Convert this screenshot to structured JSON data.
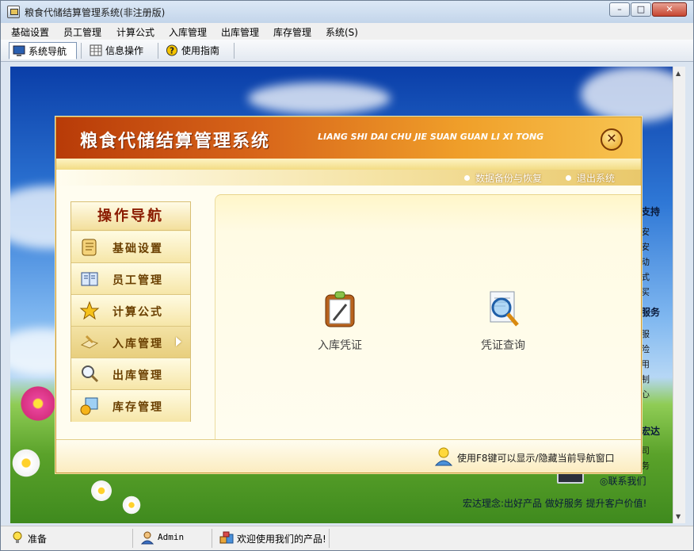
{
  "window": {
    "title": "粮食代储结算管理系统(非注册版)",
    "min_label": "–",
    "max_label": "□",
    "close_label": "✕"
  },
  "menubar": [
    "基础设置",
    "员工管理",
    "计算公式",
    "入库管理",
    "出库管理",
    "库存管理",
    "系统(S)"
  ],
  "toolbar": {
    "items": [
      {
        "label": "系统导航",
        "icon": "monitor-icon",
        "active": true
      },
      {
        "label": "信息操作",
        "icon": "grid-icon",
        "active": false
      },
      {
        "label": "使用指南",
        "icon": "help-icon",
        "active": false
      }
    ]
  },
  "dialog": {
    "title": "粮食代储结算管理系统",
    "subtitle": "LIANG SHI DAI CHU JIE SUAN GUAN LI XI TONG",
    "close_label": "✕",
    "links": [
      "数据备份与恢复",
      "退出系统"
    ],
    "nav_title": "操作导航",
    "nav_items": [
      {
        "label": "基础设置",
        "icon": "scroll-icon"
      },
      {
        "label": "员工管理",
        "icon": "book-icon"
      },
      {
        "label": "计算公式",
        "icon": "star-icon"
      },
      {
        "label": "入库管理",
        "icon": "inbound-icon",
        "active": true
      },
      {
        "label": "出库管理",
        "icon": "magnifier-icon"
      },
      {
        "label": "库存管理",
        "icon": "stock-icon"
      }
    ],
    "functions": [
      {
        "label": "入库凭证",
        "icon": "clipboard-icon"
      },
      {
        "label": "凭证查询",
        "icon": "search-document-icon"
      }
    ],
    "hint": "使用F8键可以显示/隐藏当前导航窗口"
  },
  "background": {
    "side_headings": [
      "支持",
      "服务",
      "宏达"
    ],
    "side_chars_1": [
      "安",
      "安",
      "动",
      "式",
      "买"
    ],
    "side_chars_2": [
      "服",
      "险",
      "用",
      "制",
      "心"
    ],
    "side_chars_3": [
      "司",
      "务"
    ],
    "contact": "联系我们",
    "motto": "宏达理念:出好产品 做好服务 提升客户价值!"
  },
  "statusbar": {
    "ready": "准备",
    "user": "Admin",
    "welcome": "欢迎使用我们的产品!"
  }
}
